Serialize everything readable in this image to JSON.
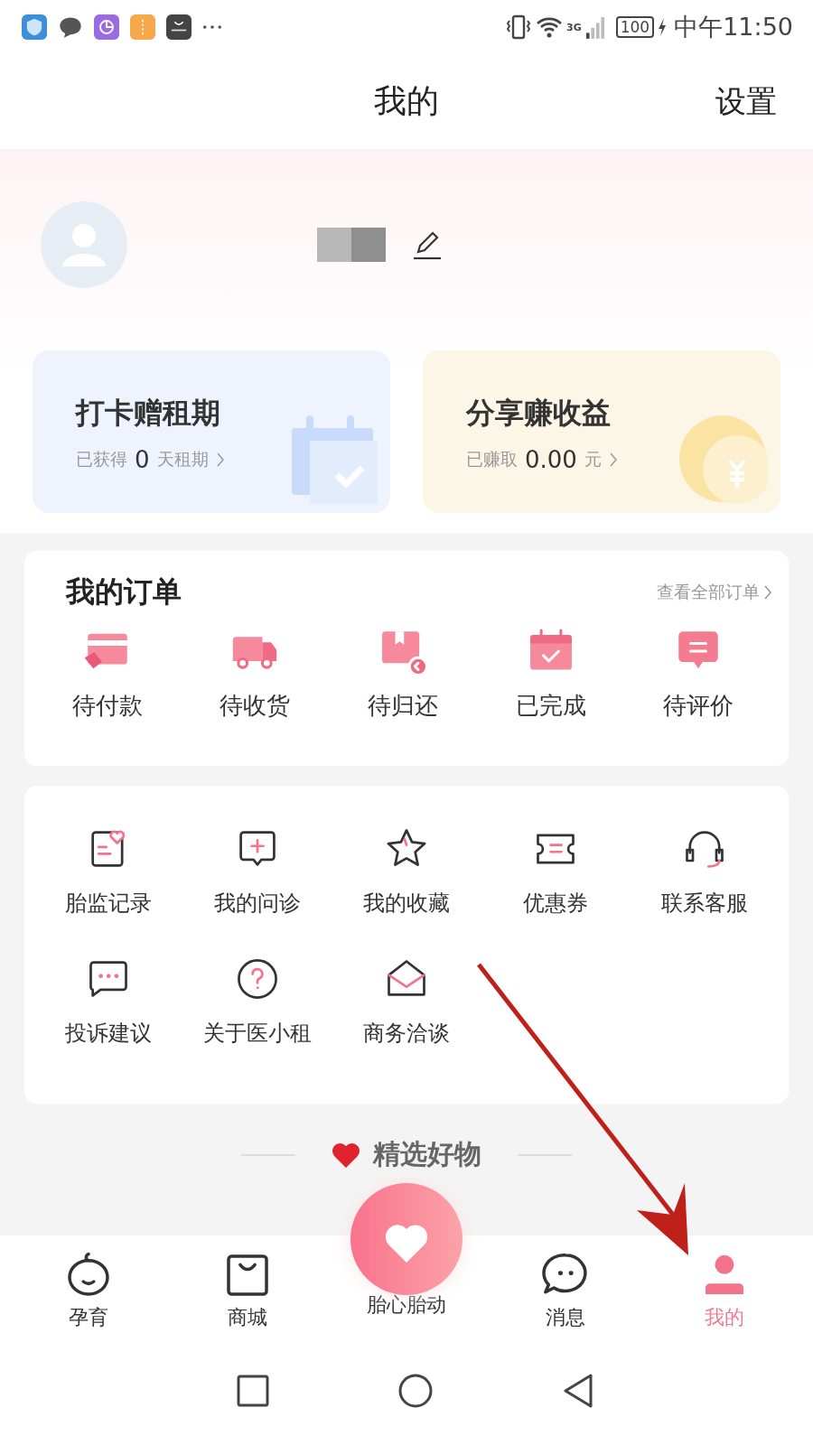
{
  "status_bar": {
    "network": "3G",
    "battery": "100",
    "time": "中午11:50"
  },
  "header": {
    "title": "我的",
    "action": "设置"
  },
  "cards": [
    {
      "kind": "checkin",
      "title": "打卡赠租期",
      "prefix": "已获得",
      "value": "0",
      "unit": "天租期"
    },
    {
      "kind": "earnings",
      "title": "分享赚收益",
      "prefix": "已赚取",
      "value": "0.00",
      "unit": "元"
    }
  ],
  "orders": {
    "title": "我的订单",
    "link": "查看全部订单",
    "items": [
      "待付款",
      "待收货",
      "待归还",
      "已完成",
      "待评价"
    ]
  },
  "services": [
    "胎监记录",
    "我的问诊",
    "我的收藏",
    "优惠券",
    "联系客服",
    "投诉建议",
    "关于医小租",
    "商务洽谈"
  ],
  "featured": {
    "title": "精选好物"
  },
  "tab_bar": [
    {
      "kind": "tab",
      "label": "孕育",
      "selected": false
    },
    {
      "kind": "tab",
      "label": "商城",
      "selected": false
    },
    {
      "kind": "center",
      "label": "胎心胎动",
      "selected": false
    },
    {
      "kind": "tab",
      "label": "消息",
      "selected": false
    },
    {
      "kind": "tab",
      "label": "我的",
      "selected": true
    }
  ]
}
